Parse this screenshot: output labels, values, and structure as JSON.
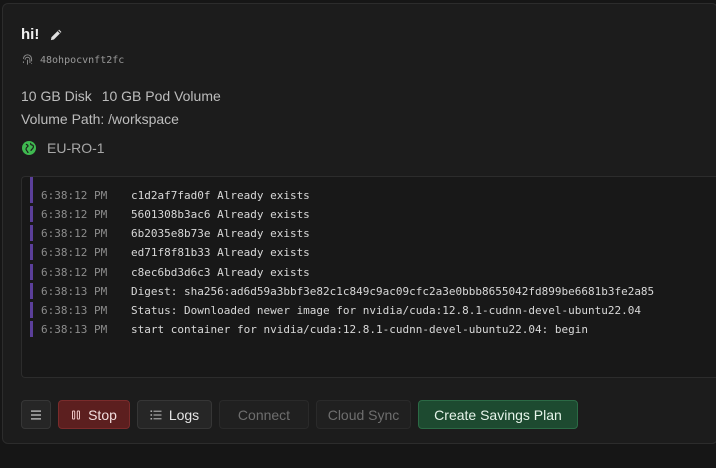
{
  "pod": {
    "name": "hi!",
    "id": "48ohpocvnft2fc",
    "disk": "10 GB Disk",
    "pod_volume": "10 GB Pod Volume",
    "volume_path": "Volume Path: /workspace",
    "region": "EU-RO-1"
  },
  "log": {
    "lines": [
      {
        "time": "6:38:12 PM",
        "msg": "c1d2af7fad0f Already exists"
      },
      {
        "time": "6:38:12 PM",
        "msg": "5601308b3ac6 Already exists"
      },
      {
        "time": "6:38:12 PM",
        "msg": "6b2035e8b73e Already exists"
      },
      {
        "time": "6:38:12 PM",
        "msg": "ed71f8f81b33 Already exists"
      },
      {
        "time": "6:38:12 PM",
        "msg": "c8ec6bd3d6c3 Already exists"
      },
      {
        "time": "6:38:13 PM",
        "msg": "Digest: sha256:ad6d59a3bbf3e82c1c849c9ac09cfc2a3e0bbb8655042fd899be6681b3fe2a85"
      },
      {
        "time": "6:38:13 PM",
        "msg": "Status: Downloaded newer image for nvidia/cuda:12.8.1-cudnn-devel-ubuntu22.04"
      },
      {
        "time": "6:38:13 PM",
        "msg": "start container for nvidia/cuda:12.8.1-cudnn-devel-ubuntu22.04: begin"
      }
    ]
  },
  "actions": {
    "stop": "Stop",
    "logs": "Logs",
    "connect": "Connect",
    "cloud_sync": "Cloud Sync",
    "savings": "Create Savings Plan"
  },
  "icons": {
    "edit": "pencil-icon",
    "id": "fingerprint-icon",
    "region": "globe-icon",
    "menu": "hamburger-icon",
    "stop": "pause-icon",
    "logs": "list-icon"
  },
  "colors": {
    "stop_bg": "#5c1f1f",
    "savings_bg": "#1d4a30",
    "region_globe": "#3fb950",
    "log_bar": "#5b3f9a"
  }
}
